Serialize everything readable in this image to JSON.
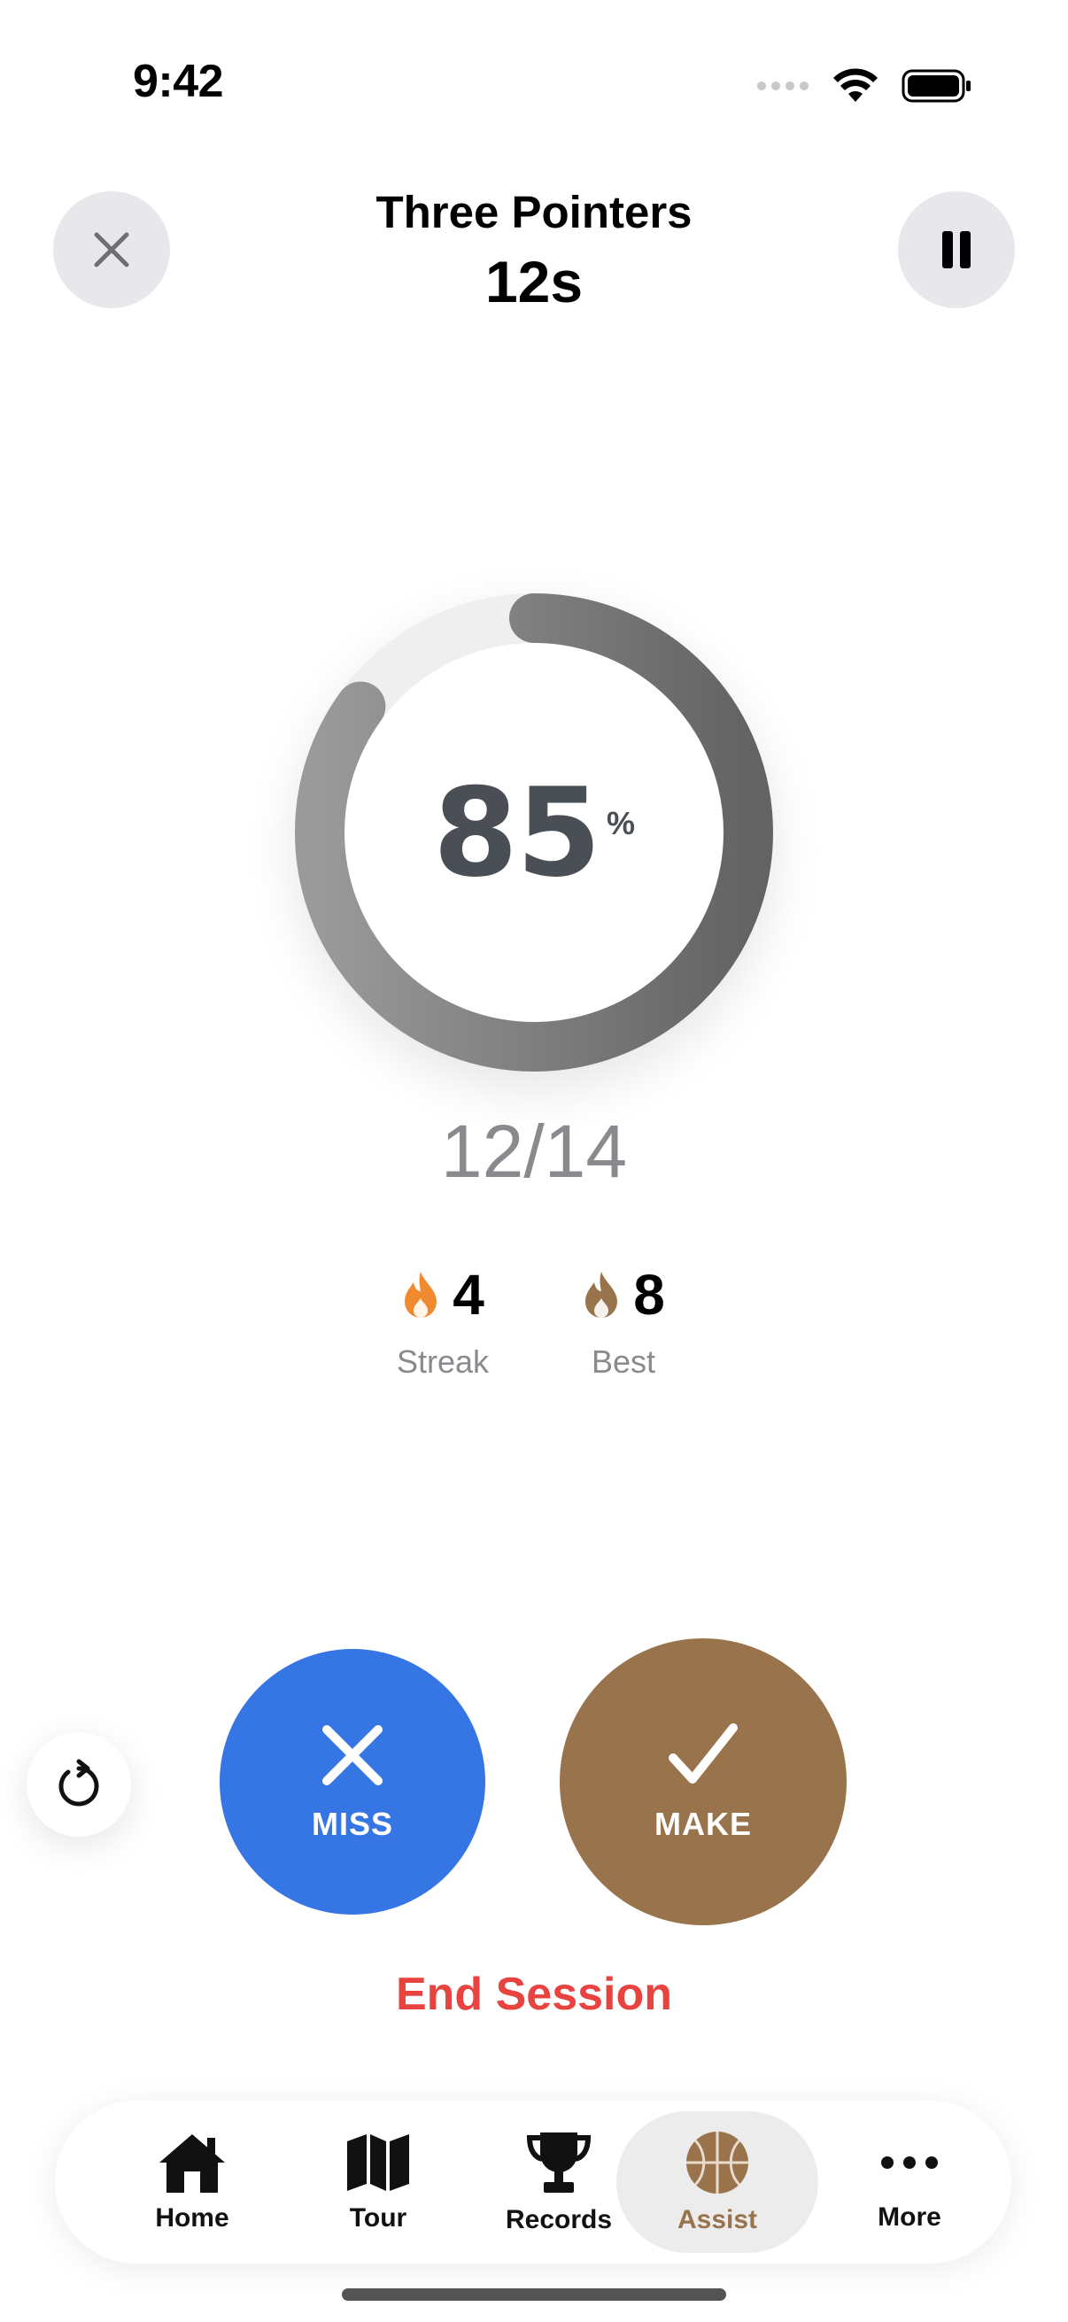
{
  "status_bar": {
    "time": "9:42"
  },
  "header": {
    "title": "Three Pointers",
    "timer": "12s"
  },
  "progress": {
    "percent_value": "85",
    "percent_sign": "%",
    "fraction_complete": 0.85,
    "shots": "12/14"
  },
  "stats": {
    "streak": {
      "value": "4",
      "label": "Streak"
    },
    "best": {
      "value": "8",
      "label": "Best"
    }
  },
  "actions": {
    "miss_label": "MISS",
    "make_label": "MAKE",
    "end_session_label": "End Session"
  },
  "tabbar": {
    "items": [
      {
        "label": "Home",
        "icon": "house-icon"
      },
      {
        "label": "Tour",
        "icon": "map-icon"
      },
      {
        "label": "Records",
        "icon": "trophy-icon"
      },
      {
        "label": "Assist",
        "icon": "basketball-icon",
        "active": true
      },
      {
        "label": "More",
        "icon": "ellipsis-icon"
      }
    ]
  },
  "colors": {
    "miss": "#3675e4",
    "make": "#99734c",
    "end_session": "#e8433f",
    "active_tab": "#99734c",
    "streak_flame": "#f08a2e",
    "best_flame": "#99734c"
  }
}
